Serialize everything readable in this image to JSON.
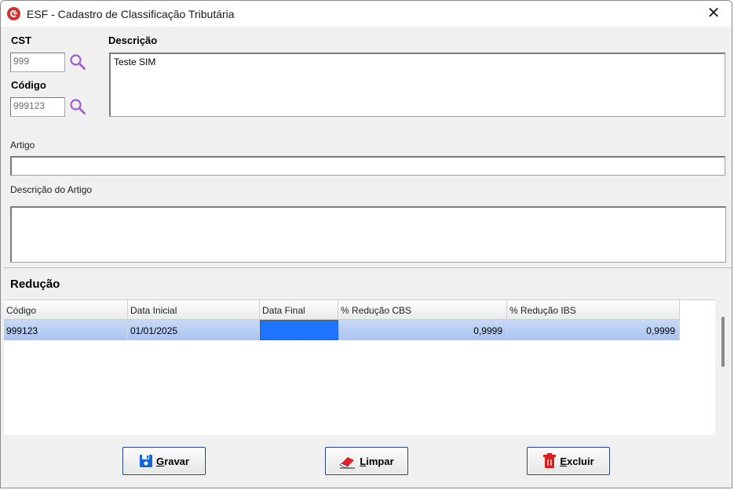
{
  "window": {
    "title": "ESF - Cadastro de Classificação Tributária",
    "close_glyph": "✕"
  },
  "form": {
    "cst_label": "CST",
    "cst_value": "999",
    "codigo_label": "Código",
    "codigo_value": "999123",
    "descricao_label": "Descrição",
    "descricao_value": "Teste SIM",
    "artigo_label": "Artigo",
    "artigo_value": "",
    "descricao_artigo_label": "Descrição do Artigo",
    "descricao_artigo_value": ""
  },
  "reducao": {
    "title": "Redução",
    "columns": [
      "Código",
      "Data Inicial",
      "Data Final",
      "% Redução CBS",
      "% Redução IBS"
    ],
    "rows": [
      {
        "codigo": "999123",
        "data_inicial": "01/01/2025",
        "data_final": "",
        "reducao_cbs": "0,9999",
        "reducao_ibs": "0,9999"
      }
    ]
  },
  "buttons": {
    "gravar": {
      "first": "G",
      "rest": "ravar"
    },
    "limpar": {
      "first": "L",
      "rest": "impar"
    },
    "excluir": {
      "first": "E",
      "rest": "xcluir"
    }
  },
  "icons": {
    "app": "app-logo-icon",
    "search": "magnifier-icon",
    "save": "floppy-disk-icon",
    "clear": "eraser-icon",
    "delete": "trash-icon"
  },
  "colors": {
    "accent_blue": "#1e73ff",
    "selected_row": "#b7cdf2",
    "search_icon": "#a35fd0",
    "brand_red": "#d63030"
  }
}
